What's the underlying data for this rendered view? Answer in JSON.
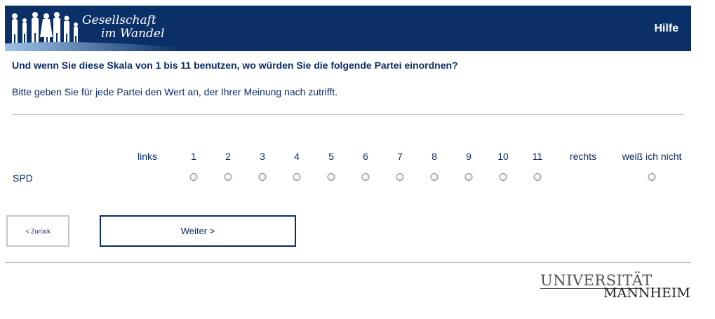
{
  "header": {
    "logo_line1": "Gesellschaft",
    "logo_line2": "im Wandel",
    "help_label": "Hilfe"
  },
  "question": "Und wenn Sie diese Skala von 1 bis 11 benutzen, wo würden Sie die folgende Partei einordnen?",
  "instruction": "Bitte geben Sie für jede Partei den Wert an, der Ihrer Meinung nach zutrifft.",
  "scale": {
    "left_label": "links",
    "values": [
      "1",
      "2",
      "3",
      "4",
      "5",
      "6",
      "7",
      "8",
      "9",
      "10",
      "11"
    ],
    "right_label": "rechts",
    "dont_know_label": "weiß ich nicht"
  },
  "rows": [
    {
      "label": "SPD",
      "selected": null
    }
  ],
  "nav": {
    "back_label": "< Zurück",
    "next_label": "Weiter >"
  },
  "footer": {
    "logo_line1": "UNIVERSITÄT",
    "logo_line2": "MANNHEIM"
  },
  "colors": {
    "header_bg": "#0b3068",
    "text": "#0b2c67"
  }
}
